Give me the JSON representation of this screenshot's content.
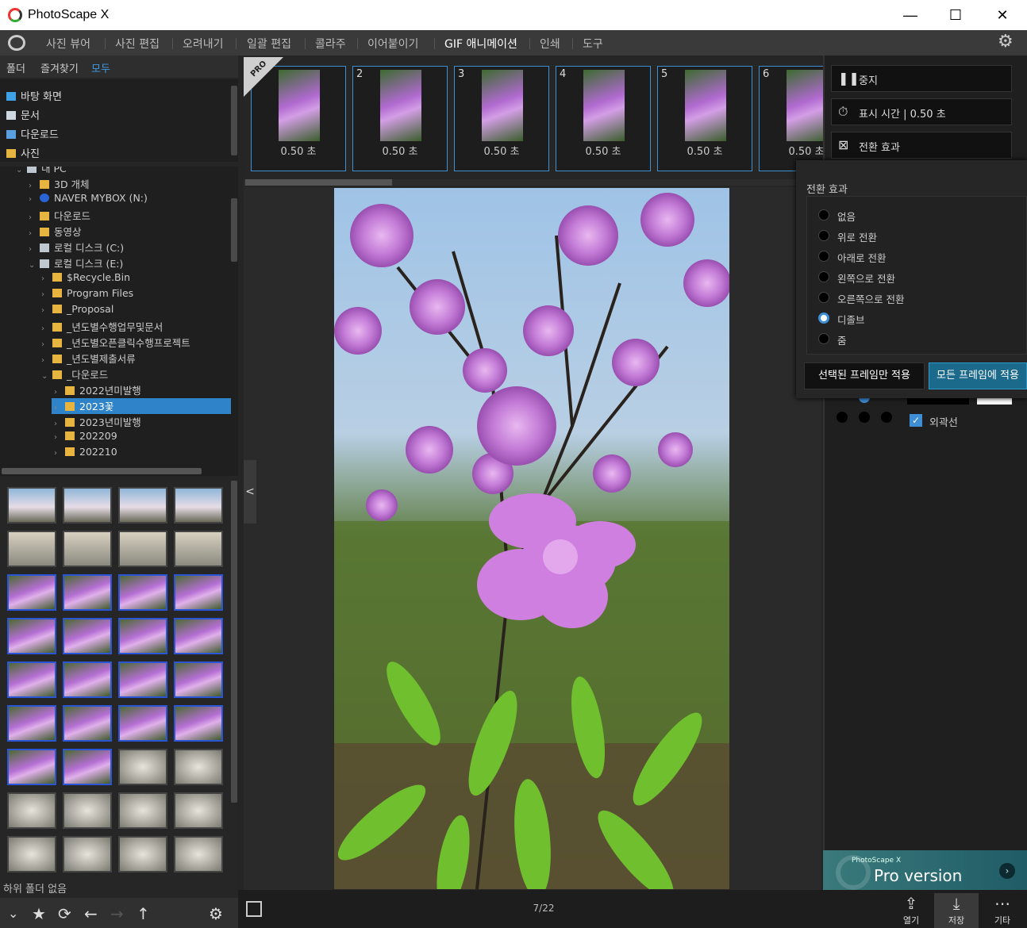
{
  "app": {
    "title": "PhotoScape X"
  },
  "window": {
    "minimize": "—",
    "maximize": "☐",
    "close": "✕"
  },
  "menu": [
    "사진 뷰어",
    "사진 편집",
    "오려내기",
    "일괄 편집",
    "콜라주",
    "이어붙이기",
    "GIF 애니메이션",
    "인쇄",
    "도구"
  ],
  "left": {
    "tabs": [
      "폴더",
      "즐겨찾기",
      "모두"
    ],
    "favorites": [
      "바탕 화면",
      "문서",
      "다운로드",
      "사진"
    ],
    "tree": [
      {
        "label": "내 PC",
        "indent": 0
      },
      {
        "label": "3D 개체",
        "indent": 1
      },
      {
        "label": "NAVER MYBOX (N:)",
        "indent": 1
      },
      {
        "label": "다운로드",
        "indent": 1
      },
      {
        "label": "동영상",
        "indent": 1
      },
      {
        "label": "로컬 디스크 (C:)",
        "indent": 1
      },
      {
        "label": "로컬 디스크 (E:)",
        "indent": 1
      },
      {
        "label": "$Recycle.Bin",
        "indent": 2
      },
      {
        "label": "Program Files",
        "indent": 2
      },
      {
        "label": "_Proposal",
        "indent": 2
      },
      {
        "label": "_년도별수행업무및문서",
        "indent": 2
      },
      {
        "label": "_년도별오픈클릭수행프로젝트",
        "indent": 2
      },
      {
        "label": "_년도별제출서류",
        "indent": 2
      },
      {
        "label": "_다운로드",
        "indent": 2
      },
      {
        "label": "2022년미발행",
        "indent": 3
      },
      {
        "label": "2023꽃",
        "indent": 3
      },
      {
        "label": "2023년미발행",
        "indent": 3
      },
      {
        "label": "202209",
        "indent": 3
      },
      {
        "label": "202210",
        "indent": 3
      }
    ],
    "status": "하위 폴더 없음"
  },
  "frames": [
    {
      "num": "",
      "dur": "0.50 초"
    },
    {
      "num": "2",
      "dur": "0.50 초"
    },
    {
      "num": "3",
      "dur": "0.50 초"
    },
    {
      "num": "4",
      "dur": "0.50 초"
    },
    {
      "num": "5",
      "dur": "0.50 초"
    },
    {
      "num": "6",
      "dur": "0.50 초"
    }
  ],
  "pro_badge": "PRO",
  "counter": "7/22",
  "bottom": {
    "open": "열기",
    "save": "저장",
    "more": "기타"
  },
  "right": {
    "stop": "중지",
    "display_time": "표시 시간 | 0.50 초",
    "transition": "전환 효과",
    "outline": "외곽선",
    "pro_banner_small": "PhotoScape X",
    "pro_banner": "Pro version"
  },
  "popup": {
    "heading": "전환 효과",
    "options": [
      "없음",
      "위로 전환",
      "아래로 전환",
      "왼쪽으로 전환",
      "오른쪽으로 전환",
      "디졸브",
      "줌"
    ],
    "selected_index": 5,
    "apply_selected": "선택된 프레임만 적용",
    "apply_all": "모든 프레임에 적용"
  },
  "colors": {
    "accent": "#2f83c8",
    "selected_thumb": "#2a55d6"
  }
}
